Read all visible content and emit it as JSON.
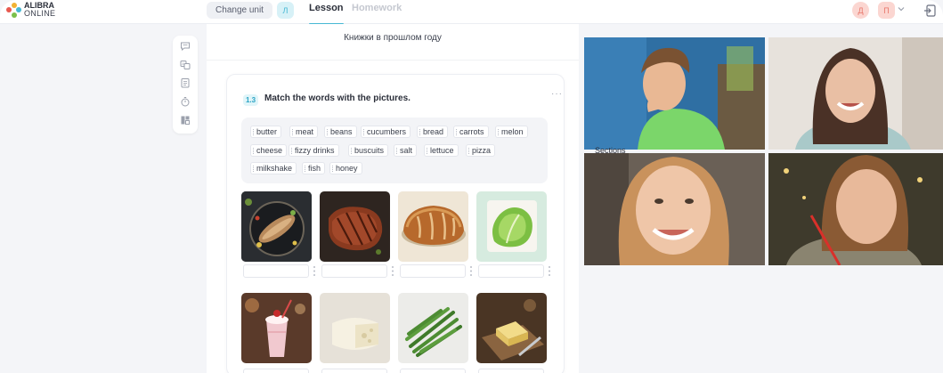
{
  "brand": {
    "line1": "ALIBRA",
    "line2": "ONLINE"
  },
  "header": {
    "change_unit": "Change unit",
    "unit_badge": "Л",
    "tabs": [
      {
        "label": "Lesson"
      },
      {
        "label": "Homework"
      }
    ],
    "user_badge_1": "Д",
    "user_badge_2": "П"
  },
  "toolbar": {
    "icons": [
      "chat-icon",
      "translate-icon",
      "notes-icon",
      "timer-icon",
      "layout-icon"
    ]
  },
  "lesson": {
    "section_title": "Книжки в прошлом году",
    "exercise": {
      "number": "1.3",
      "title": "Match the words with the pictures.",
      "words": [
        "butter",
        "meat",
        "beans",
        "cucumbers",
        "bread",
        "carrots",
        "melon",
        "cheese",
        "fizzy drinks",
        "buscuits",
        "salt",
        "lettuce",
        "pizza",
        "milkshake",
        "fish",
        "honey"
      ],
      "pictures": [
        "fish-picture",
        "meat-picture",
        "bread-picture",
        "lettuce-picture",
        "milkshake-picture",
        "cheese-picture",
        "beans-picture",
        "butter-picture"
      ]
    }
  },
  "video": {
    "participants": [
      "student-boy",
      "teacher",
      "student-girl-1",
      "student-girl-2"
    ],
    "partial_label": "Sections"
  },
  "colors": {
    "accent": "#46b8d4",
    "badge_bg": "#fbd6d1",
    "badge_text": "#e8776b"
  }
}
